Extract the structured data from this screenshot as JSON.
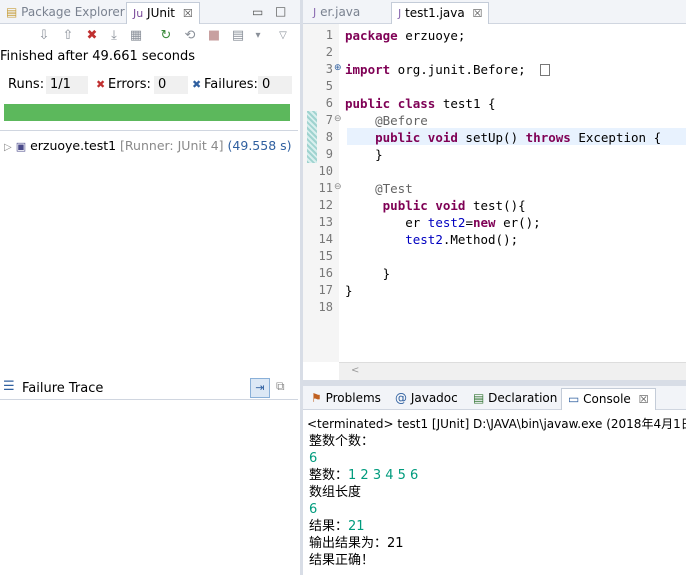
{
  "left": {
    "tabs": [
      {
        "label": "Package Explorer"
      },
      {
        "label": "JUnit",
        "close": "☒"
      }
    ],
    "status": "Finished after 49.661 seconds",
    "counters": {
      "runs_label": "Runs:",
      "runs_value": "1/1",
      "errors_label": "Errors:",
      "errors_value": "0",
      "failures_label": "Failures:",
      "failures_value": "0"
    },
    "progress_fraction": 1.0,
    "progress_color": "#5cb85c",
    "tree_item": {
      "name": "erzuoye.test1",
      "runner": "[Runner: JUnit 4]",
      "time": "(49.558 s)"
    },
    "failure_trace_label": "Failure Trace"
  },
  "editor": {
    "tabs": [
      {
        "label": "er.java"
      },
      {
        "label": "test1.java",
        "close": "☒"
      }
    ],
    "lines": [
      {
        "n": "1",
        "parts": [
          {
            "c": "kw",
            "t": "package"
          },
          {
            "c": "",
            "t": " erzuoye;"
          }
        ]
      },
      {
        "n": "2",
        "parts": []
      },
      {
        "n": "3",
        "parts": [
          {
            "c": "kw",
            "t": "import"
          },
          {
            "c": "",
            "t": " org.junit.Before;"
          }
        ]
      },
      {
        "n": "5",
        "parts": []
      },
      {
        "n": "6",
        "parts": [
          {
            "c": "kw",
            "t": "public"
          },
          {
            "c": "",
            "t": " "
          },
          {
            "c": "kw",
            "t": "class"
          },
          {
            "c": "",
            "t": " test1 {"
          }
        ]
      },
      {
        "n": "7",
        "parts": [
          {
            "c": "",
            "t": "    "
          },
          {
            "c": "ann",
            "t": "@Before"
          }
        ]
      },
      {
        "n": "8",
        "parts": [
          {
            "c": "",
            "t": "    "
          },
          {
            "c": "kw",
            "t": "public"
          },
          {
            "c": "",
            "t": " "
          },
          {
            "c": "kw",
            "t": "void"
          },
          {
            "c": "",
            "t": " setUp() "
          },
          {
            "c": "kw",
            "t": "throws"
          },
          {
            "c": "",
            "t": " Exception {"
          }
        ]
      },
      {
        "n": "9",
        "parts": [
          {
            "c": "",
            "t": "    }"
          }
        ]
      },
      {
        "n": "10",
        "parts": []
      },
      {
        "n": "11",
        "parts": [
          {
            "c": "",
            "t": "    "
          },
          {
            "c": "ann",
            "t": "@Test"
          }
        ]
      },
      {
        "n": "12",
        "parts": [
          {
            "c": "",
            "t": "     "
          },
          {
            "c": "kw",
            "t": "public"
          },
          {
            "c": "",
            "t": " "
          },
          {
            "c": "kw",
            "t": "void"
          },
          {
            "c": "",
            "t": " test(){"
          }
        ]
      },
      {
        "n": "13",
        "parts": [
          {
            "c": "",
            "t": "        er "
          },
          {
            "c": "var",
            "t": "test2"
          },
          {
            "c": "",
            "t": "="
          },
          {
            "c": "kw",
            "t": "new"
          },
          {
            "c": "",
            "t": " er();"
          }
        ]
      },
      {
        "n": "14",
        "parts": [
          {
            "c": "",
            "t": "        "
          },
          {
            "c": "var",
            "t": "test2"
          },
          {
            "c": "",
            "t": ".Method();"
          }
        ]
      },
      {
        "n": "15",
        "parts": []
      },
      {
        "n": "16",
        "parts": [
          {
            "c": "",
            "t": "     }"
          }
        ]
      },
      {
        "n": "17",
        "parts": [
          {
            "c": "",
            "t": "}"
          }
        ]
      },
      {
        "n": "18",
        "parts": []
      }
    ]
  },
  "console": {
    "tabs": [
      {
        "label": "Problems"
      },
      {
        "label": "Javadoc"
      },
      {
        "label": "Declaration"
      },
      {
        "label": "Console",
        "close": "☒"
      }
    ],
    "header": "<terminated> test1 [JUnit] D:\\JAVA\\bin\\javaw.exe (2018年4月1日 下",
    "lines": [
      {
        "parts": [
          {
            "c": "",
            "t": "整数个数："
          }
        ]
      },
      {
        "parts": [
          {
            "c": "green",
            "t": "6"
          }
        ]
      },
      {
        "parts": [
          {
            "c": "",
            "t": "整数："
          },
          {
            "c": "green",
            "t": "1 2 3 4 5 6"
          }
        ]
      },
      {
        "parts": [
          {
            "c": "",
            "t": "数组长度"
          }
        ]
      },
      {
        "parts": [
          {
            "c": "green",
            "t": "6"
          }
        ]
      },
      {
        "parts": [
          {
            "c": "",
            "t": "结果："
          },
          {
            "c": "green",
            "t": "21"
          }
        ]
      },
      {
        "parts": [
          {
            "c": "",
            "t": "输出结果为：21"
          }
        ]
      },
      {
        "parts": [
          {
            "c": "",
            "t": "结果正确！"
          }
        ]
      }
    ]
  }
}
